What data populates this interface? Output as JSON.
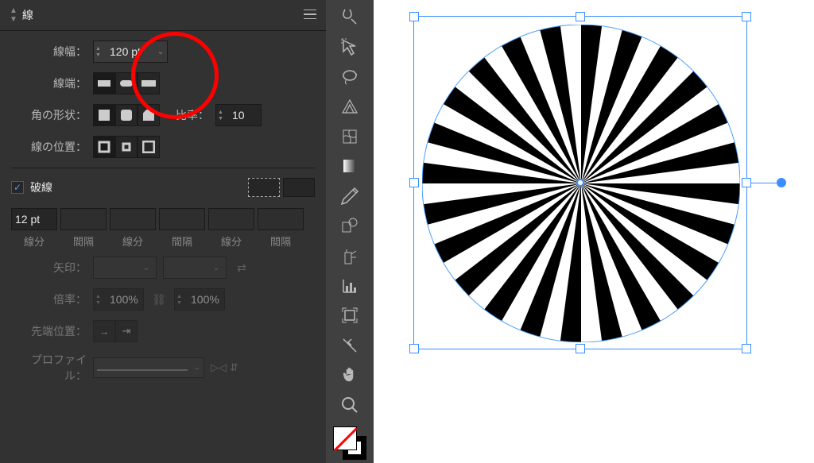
{
  "panel": {
    "title": "線",
    "strokeWidth": {
      "label": "線幅：",
      "value": "120 pt"
    },
    "cap": {
      "label": "線端："
    },
    "corner": {
      "label": "角の形状：",
      "ratioLabel": "比率：",
      "ratioValue": "10"
    },
    "align": {
      "label": "線の位置："
    },
    "dashed": {
      "label": "破線",
      "checked": true,
      "inputs": [
        "12 pt",
        "",
        "",
        "",
        "",
        ""
      ],
      "labels": [
        "線分",
        "間隔",
        "線分",
        "間隔",
        "線分",
        "間隔"
      ]
    },
    "arrow": {
      "label": "矢印："
    },
    "scale": {
      "label": "倍率：",
      "value1": "100%",
      "value2": "100%"
    },
    "tip": {
      "label": "先端位置："
    },
    "profile": {
      "label": "プロファイル："
    }
  },
  "toolbar": {
    "tools": [
      "artboard-icon",
      "lasso-icon",
      "curvature-icon",
      "width-icon",
      "warp-icon",
      "gradient-icon",
      "eyedropper-icon",
      "blend-icon",
      "symbol-icon",
      "graph-icon",
      "crop-icon",
      "slice-icon",
      "hand-icon",
      "zoom-icon"
    ]
  }
}
